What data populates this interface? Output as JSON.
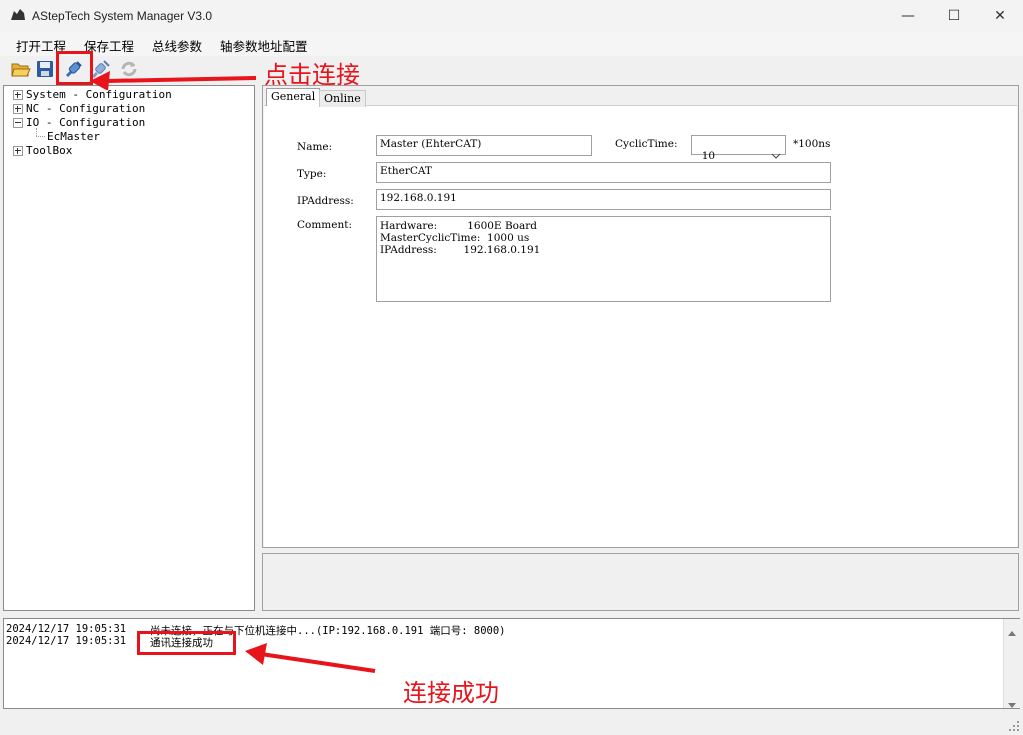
{
  "window": {
    "title": "AStepTech System Manager V3.0",
    "minimize": "—",
    "maximize": "☐",
    "close": "✕"
  },
  "menu": {
    "items": [
      "打开工程",
      "保存工程",
      "总线参数",
      "轴参数地址配置"
    ]
  },
  "toolbar": {
    "icons": [
      "open-folder-icon",
      "save-icon",
      "connect-icon",
      "disconnect-icon",
      "refresh-icon"
    ]
  },
  "tree": {
    "items": [
      {
        "label": "System - Configuration",
        "state": "collapsed"
      },
      {
        "label": "NC - Configuration",
        "state": "collapsed"
      },
      {
        "label": "IO - Configuration",
        "state": "expanded"
      },
      {
        "label": "EcMaster",
        "state": "leaf"
      },
      {
        "label": "ToolBox",
        "state": "collapsed"
      }
    ]
  },
  "tabs": [
    "General",
    "Online"
  ],
  "form": {
    "name_label": "Name:",
    "name_value": "Master (EhterCAT)",
    "cyclic_label": "CyclicTime:",
    "cyclic_value": "10",
    "cyclic_unit": "*100ns",
    "type_label": "Type:",
    "type_value": "EtherCAT",
    "ip_label": "IPAddress:",
    "ip_value": "192.168.0.191",
    "comment_label": "Comment:",
    "comment_value": "Hardware:         1600E Board\nMasterCyclicTime:  1000 us\nIPAddress:        192.168.0.191"
  },
  "log": {
    "lines": [
      {
        "time": "2024/12/17 19:05:31",
        "msg": "尚未连接，正在与下位机连接中...(IP:192.168.0.191 端口号: 8000)"
      },
      {
        "time": "2024/12/17 19:05:31",
        "msg": "通讯连接成功"
      }
    ]
  },
  "annotations": {
    "click_connect": "点击连接",
    "connect_success": "连接成功",
    "color": "#e8141b"
  }
}
